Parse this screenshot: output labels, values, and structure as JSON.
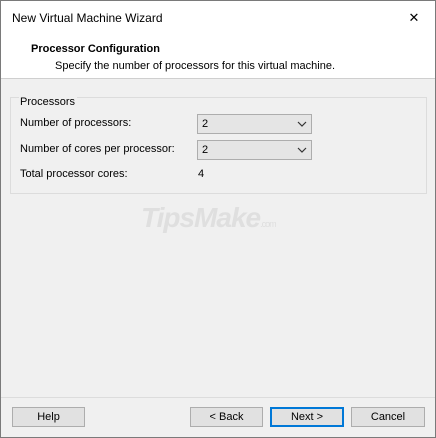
{
  "window": {
    "title": "New Virtual Machine Wizard",
    "close_glyph": "✕"
  },
  "header": {
    "title": "Processor Configuration",
    "subtitle": "Specify the number of processors for this virtual machine."
  },
  "processors": {
    "group_label": "Processors",
    "num_processors_label": "Number of processors:",
    "num_processors_value": "2",
    "cores_per_processor_label": "Number of cores per processor:",
    "cores_per_processor_value": "2",
    "total_cores_label": "Total processor cores:",
    "total_cores_value": "4"
  },
  "watermark": {
    "text": "TipsMake",
    "suffix": ".com"
  },
  "buttons": {
    "help": "Help",
    "back": "< Back",
    "next": "Next >",
    "cancel": "Cancel"
  },
  "icons": {
    "close": "close-icon",
    "dropdown": "chevron-down-icon"
  }
}
